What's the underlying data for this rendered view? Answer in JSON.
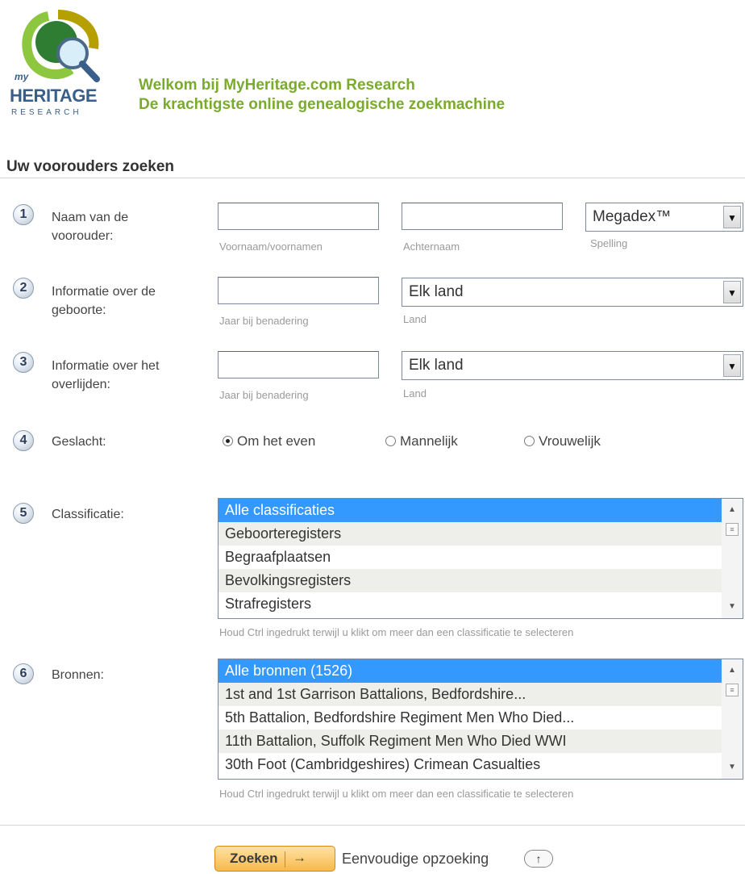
{
  "logo": {
    "my": "my",
    "word": "HERITAGE",
    "sub": "RESEARCH"
  },
  "welcome": {
    "line1": "Welkom bij MyHeritage.com Research",
    "line2": "De krachtigste online genealogische zoekmachine"
  },
  "section_title": "Uw voorouders zoeken",
  "rows": {
    "name": {
      "number": "1",
      "label_line1": "Naam van de",
      "label_line2": "voorouder:",
      "first_name_hint": "Voornaam/voornamen",
      "last_name_hint": "Achternaam",
      "spelling_value": "Megadex™",
      "spelling_hint": "Spelling"
    },
    "birth": {
      "number": "2",
      "label_line1": "Informatie over de",
      "label_line2": "geboorte:",
      "year_hint": "Jaar bij benadering",
      "country_value": "Elk land",
      "country_hint": "Land"
    },
    "death": {
      "number": "3",
      "label_line1": "Informatie over het",
      "label_line2": "overlijden:",
      "year_hint": "Jaar bij benadering",
      "country_value": "Elk land",
      "country_hint": "Land"
    },
    "gender": {
      "number": "4",
      "label": "Geslacht:",
      "options": [
        "Om het even",
        "Mannelijk",
        "Vrouwelijk"
      ],
      "selected": "Om het even"
    },
    "classification": {
      "number": "5",
      "label": "Classificatie:",
      "items": [
        "Alle classificaties",
        "Geboorteregisters",
        "Begraafplaatsen",
        "Bevolkingsregisters",
        "Strafregisters"
      ],
      "selected": "Alle classificaties",
      "hint": "Houd Ctrl ingedrukt terwijl u klikt om meer dan een classificatie te selecteren"
    },
    "sources": {
      "number": "6",
      "label": "Bronnen:",
      "items": [
        "Alle bronnen (1526)",
        "1st and 1st Garrison Battalions, Bedfordshire...",
        "5th Battalion, Bedfordshire Regiment Men Who Died...",
        "11th Battalion, Suffolk Regiment Men Who Died WWI",
        "30th Foot (Cambridgeshires) Crimean Casualties"
      ],
      "selected": "Alle bronnen (1526)",
      "hint": "Houd Ctrl ingedrukt terwijl u klikt om meer dan een classificatie te selecteren"
    }
  },
  "actions": {
    "search_label": "Zoeken",
    "search_arrow": "→",
    "simple_search_label": "Eenvoudige opzoeking",
    "up_glyph": "↑"
  },
  "colors": {
    "brand_green": "#7aab2c",
    "brand_blue": "#3a5e8a",
    "selection": "#3399ff",
    "button_orange": "#f7b94b"
  }
}
